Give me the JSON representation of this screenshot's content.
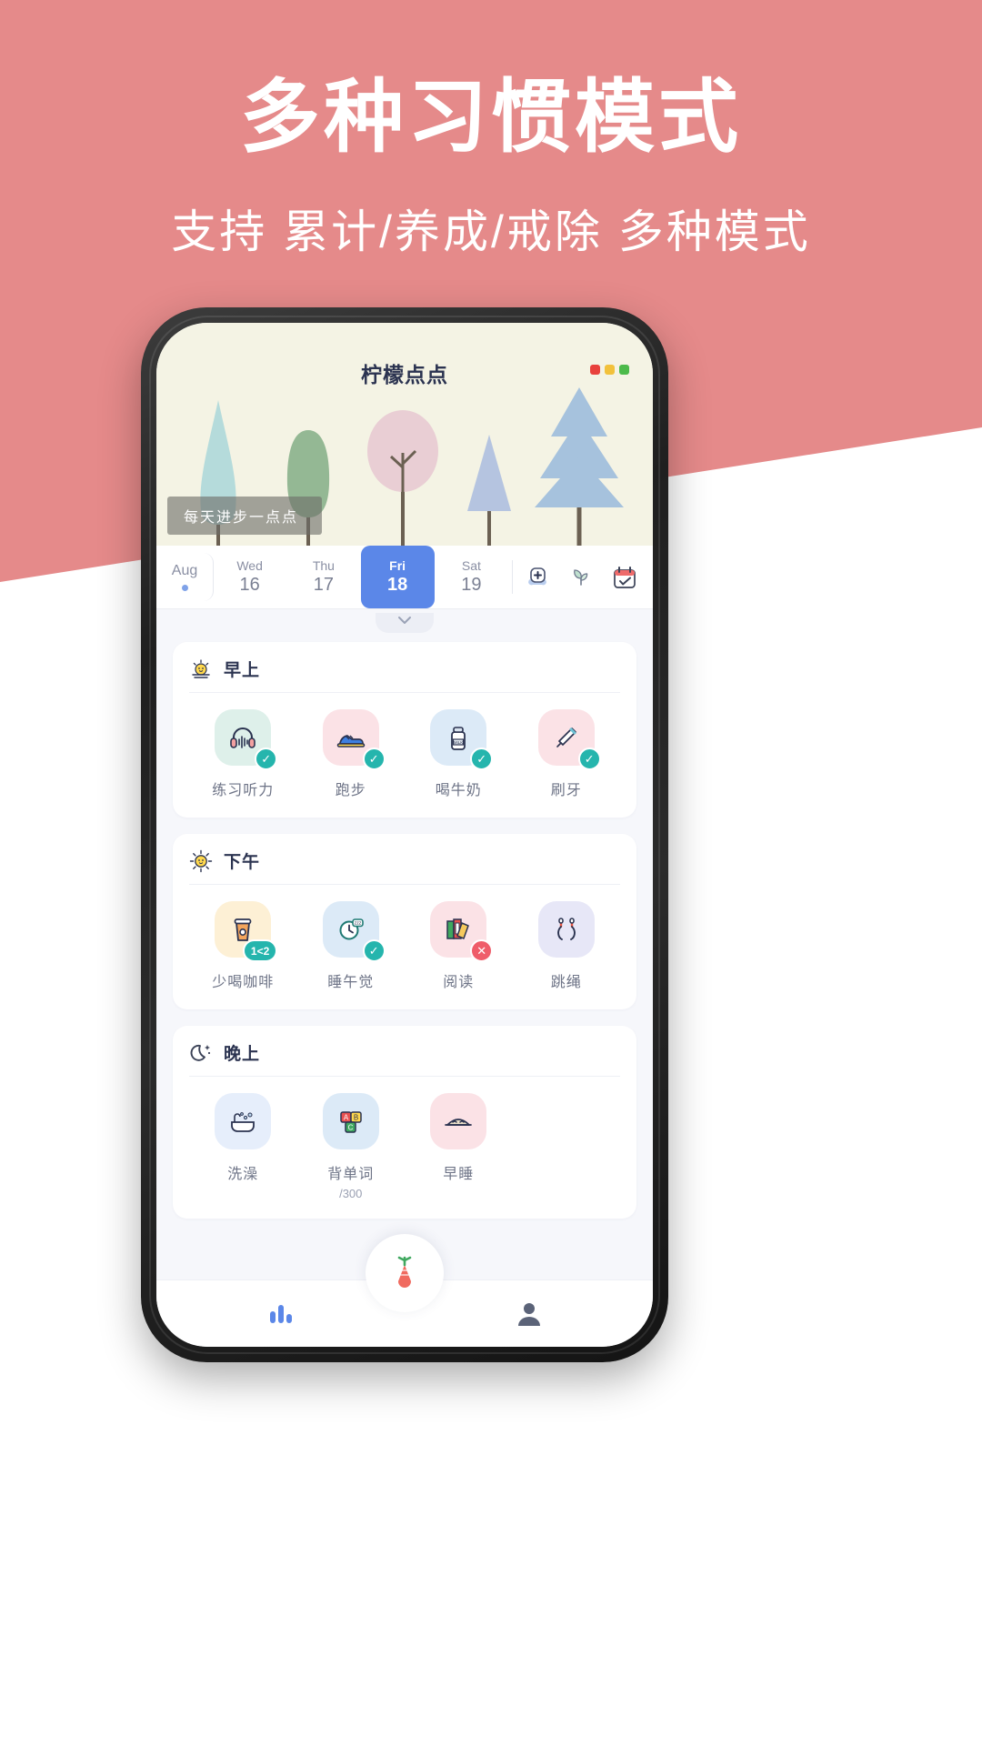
{
  "promo": {
    "title": "多种习惯模式",
    "subtitle": "支持 累计/养成/戒除 多种模式",
    "bg_color": "#e58a8a",
    "text_color": "#ffffff"
  },
  "app": {
    "title": "柠檬点点",
    "banner": "每天进步一点点",
    "window_dots": [
      "#e8413c",
      "#f2c13b",
      "#4cba4a"
    ]
  },
  "datebar": {
    "month": "Aug",
    "days": [
      {
        "dow": "Wed",
        "num": "16",
        "active": false
      },
      {
        "dow": "Thu",
        "num": "17",
        "active": false
      },
      {
        "dow": "Fri",
        "num": "18",
        "active": true
      },
      {
        "dow": "Sat",
        "num": "19",
        "active": false
      }
    ],
    "actions": [
      "add-habit-icon",
      "plant-icon",
      "calendar-icon"
    ],
    "active_color": "#5b87e8"
  },
  "sections": [
    {
      "title": "早上",
      "icon": "sunrise-icon",
      "habits": [
        {
          "label": "练习听力",
          "icon": "headphones-icon",
          "tile": "#def0ea",
          "badge": "check",
          "badge_text": "✓"
        },
        {
          "label": "跑步",
          "icon": "running-shoe-icon",
          "tile": "#fbe2e6",
          "badge": "check",
          "badge_text": "✓"
        },
        {
          "label": "喝牛奶",
          "icon": "milk-bottle-icon",
          "tile": "#dceaf7",
          "badge": "check",
          "badge_text": "✓"
        },
        {
          "label": "刷牙",
          "icon": "toothbrush-icon",
          "tile": "#fbe2e6",
          "badge": "check",
          "badge_text": "✓"
        }
      ]
    },
    {
      "title": "下午",
      "icon": "sun-icon",
      "habits": [
        {
          "label": "少喝咖啡",
          "icon": "coffee-cup-icon",
          "tile": "#fdf0d5",
          "badge": "count",
          "badge_text": "1<2"
        },
        {
          "label": "睡午觉",
          "icon": "clock-sleep-icon",
          "tile": "#dceaf7",
          "badge": "check",
          "badge_text": "✓"
        },
        {
          "label": "阅读",
          "icon": "books-icon",
          "tile": "#fbe2e6",
          "badge": "cross",
          "badge_text": "✕"
        },
        {
          "label": "跳绳",
          "icon": "jump-rope-icon",
          "tile": "#e7e7f7",
          "badge": "none",
          "badge_text": ""
        }
      ]
    },
    {
      "title": "晚上",
      "icon": "moon-icon",
      "habits": [
        {
          "label": "洗澡",
          "icon": "bathtub-icon",
          "tile": "#e6eefb",
          "badge": "none",
          "badge_text": ""
        },
        {
          "label": "背单词",
          "icon": "abc-blocks-icon",
          "tile": "#dceaf7",
          "badge": "none",
          "badge_text": "",
          "sub": "/300"
        },
        {
          "label": "早睡",
          "icon": "sleeping-face-icon",
          "tile": "#fbe2e6",
          "badge": "none",
          "badge_text": ""
        }
      ]
    }
  ],
  "bottomnav": {
    "items": [
      "stats-icon",
      "profile-icon"
    ],
    "fab": "carrot-icon"
  }
}
